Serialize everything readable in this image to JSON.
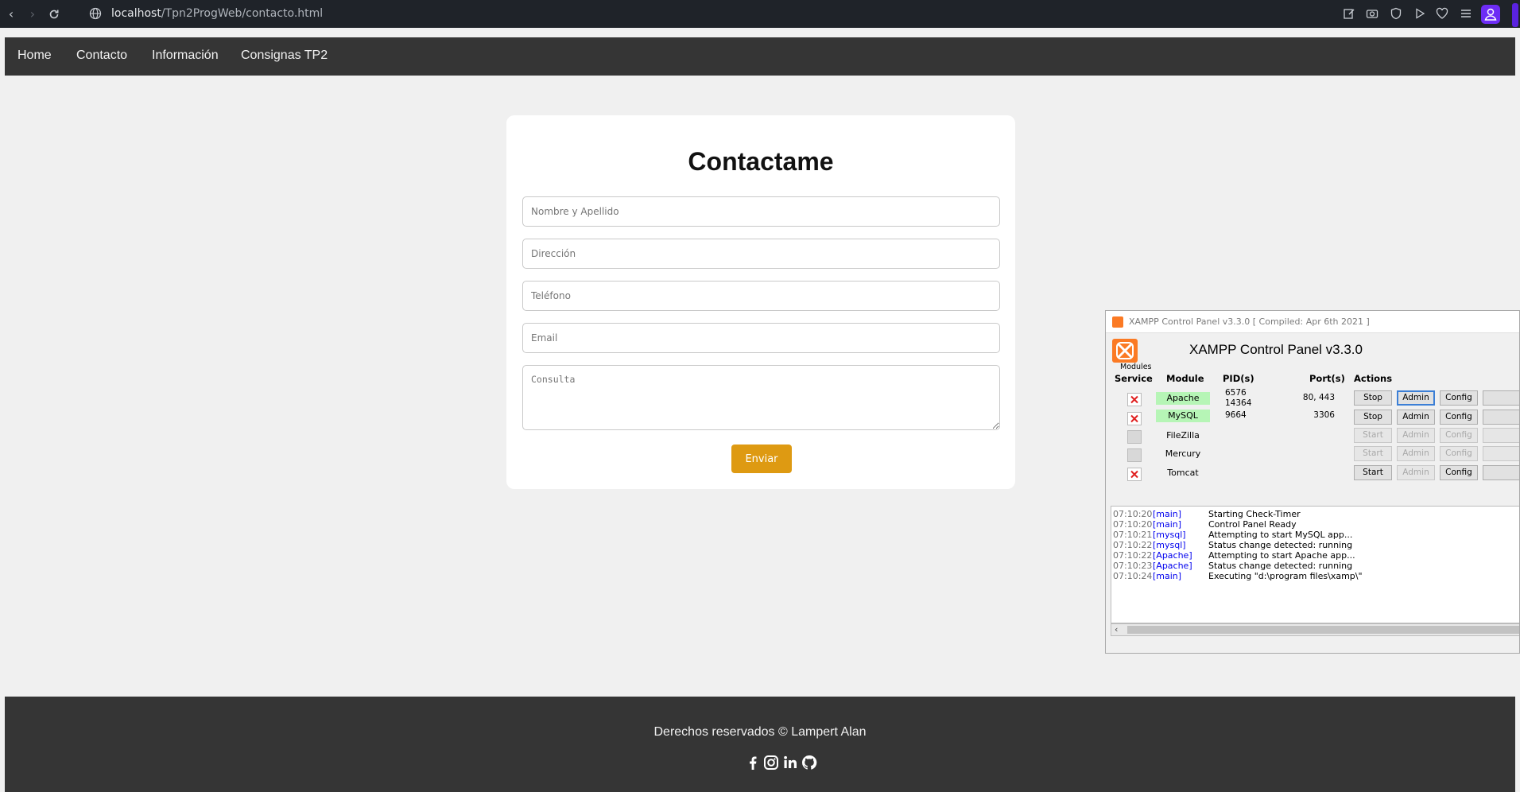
{
  "browser": {
    "url_host": "localhost",
    "url_path": "/Tpn2ProgWeb/contacto.html"
  },
  "nav": {
    "items": [
      "Home",
      "Contacto",
      "Información",
      "Consignas TP2"
    ]
  },
  "contact": {
    "title": "Contactame",
    "fields": {
      "name_placeholder": "Nombre y Apellido",
      "address_placeholder": "Dirección",
      "phone_placeholder": "Teléfono",
      "email_placeholder": "Email",
      "query_placeholder": "Consulta"
    },
    "submit_label": "Enviar",
    "accent_color": "#de9a12"
  },
  "xampp": {
    "window_title": "XAMPP Control Panel v3.3.0   [ Compiled: Apr 6th 2021 ]",
    "header": "XAMPP Control Panel v3.3.0",
    "modules_label": "Modules",
    "columns": {
      "service": "Service",
      "module": "Module",
      "pids": "PID(s)",
      "ports": "Port(s)",
      "actions": "Actions"
    },
    "modules": [
      {
        "name": "Apache",
        "pid1": "6576",
        "pid2": "14364",
        "ports": "80, 443",
        "action": "Stop",
        "admin": "Admin",
        "config": "Config"
      },
      {
        "name": "MySQL",
        "pid1": "9664",
        "pid2": "",
        "ports": "3306",
        "action": "Stop",
        "admin": "Admin",
        "config": "Config"
      },
      {
        "name": "FileZilla",
        "pid1": "",
        "pid2": "",
        "ports": "",
        "action": "Start",
        "admin": "Admin",
        "config": "Config"
      },
      {
        "name": "Mercury",
        "pid1": "",
        "pid2": "",
        "ports": "",
        "action": "Start",
        "admin": "Admin",
        "config": "Config"
      },
      {
        "name": "Tomcat",
        "pid1": "",
        "pid2": "",
        "ports": "",
        "action": "Start",
        "admin": "Admin",
        "config": "Config"
      }
    ],
    "log": [
      {
        "time": "07:10:20",
        "src": "[main]",
        "msg": "Starting Check-Timer"
      },
      {
        "time": "07:10:20",
        "src": "[main]",
        "msg": "Control Panel Ready"
      },
      {
        "time": "07:10:21",
        "src": "[mysql]",
        "msg": "Attempting to start MySQL app..."
      },
      {
        "time": "07:10:22",
        "src": "[mysql]",
        "msg": "Status change detected: running"
      },
      {
        "time": "07:10:22",
        "src": "[Apache]",
        "msg": "Attempting to start Apache app..."
      },
      {
        "time": "07:10:23",
        "src": "[Apache]",
        "msg": "Status change detected: running"
      },
      {
        "time": "07:10:24",
        "src": "[main]",
        "msg": "Executing \"d:\\program files\\xamp\\\""
      }
    ]
  },
  "footer": {
    "copyright": "Derechos reservados © Lampert Alan",
    "social_icons": [
      "facebook-icon",
      "instagram-icon",
      "linkedin-icon",
      "github-icon"
    ]
  }
}
